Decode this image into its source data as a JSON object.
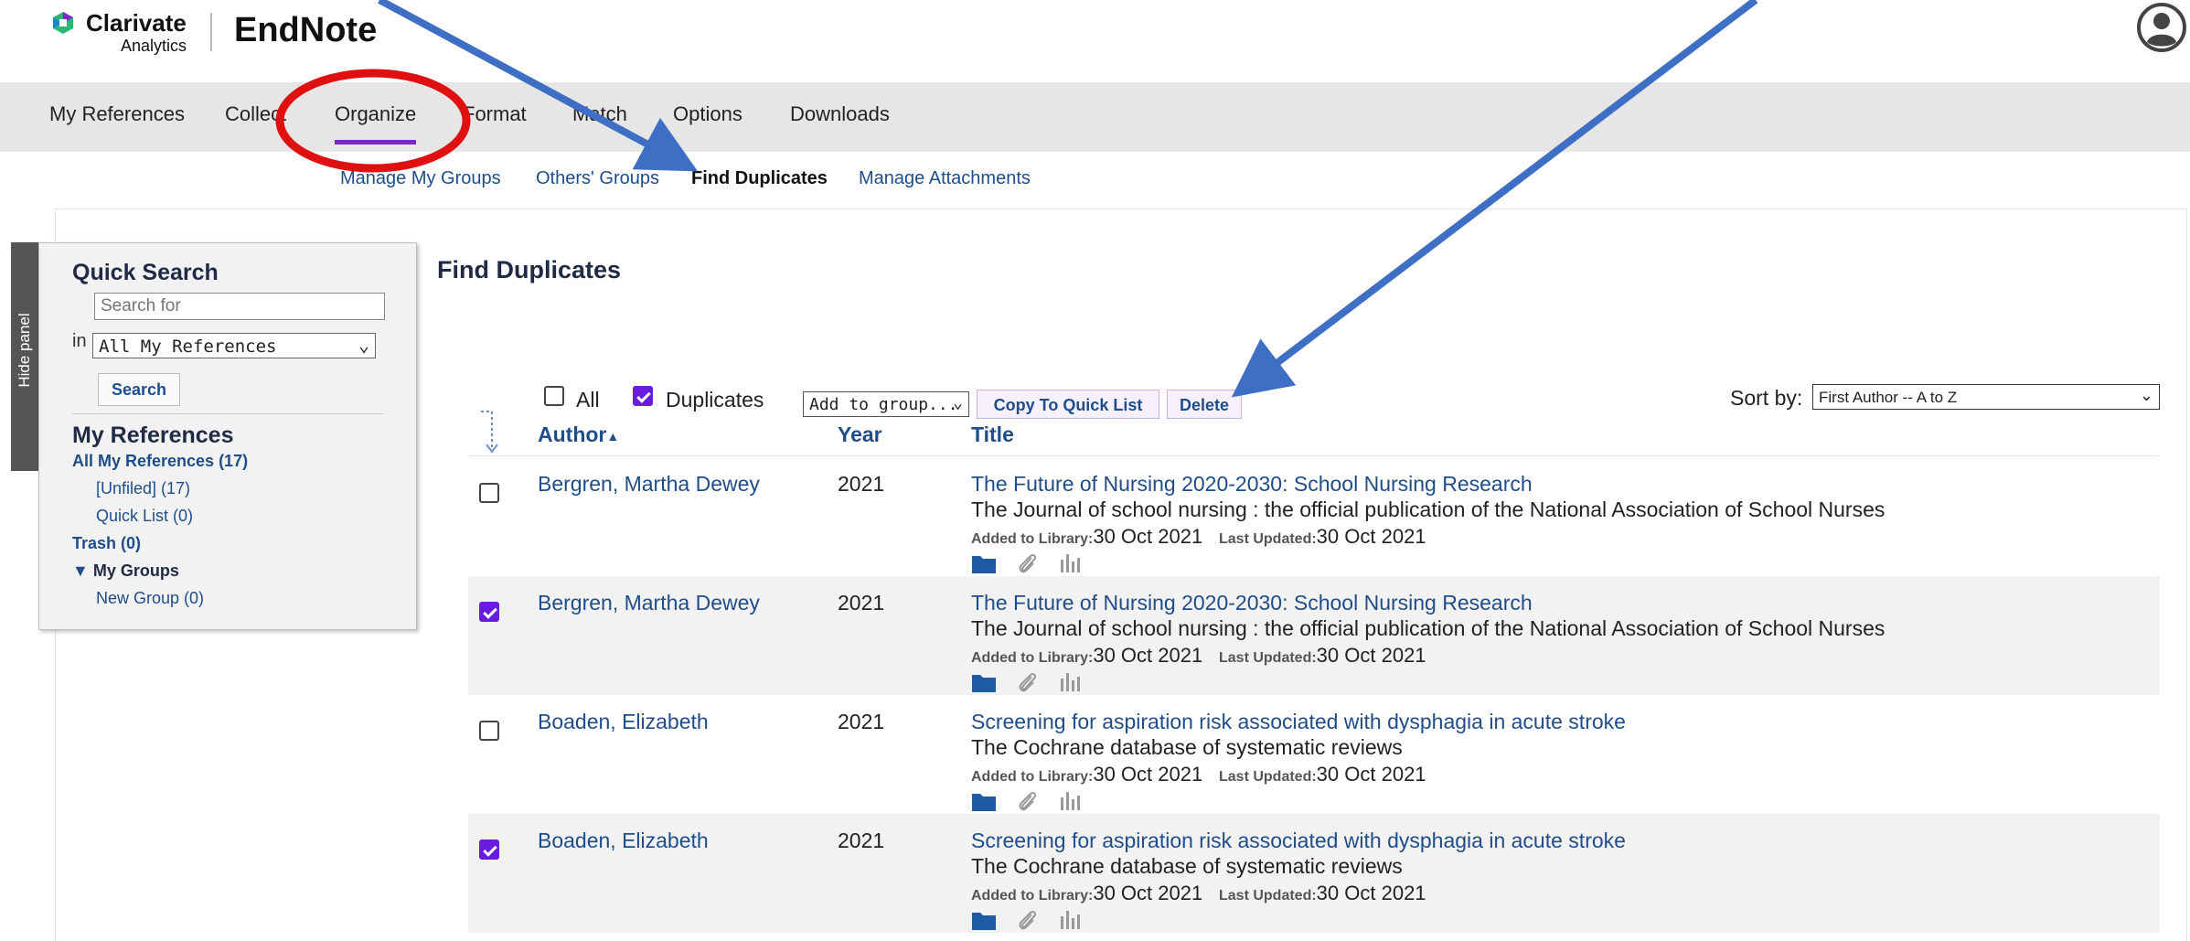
{
  "brand": {
    "company_line1": "Clarivate",
    "company_line2": "Analytics",
    "product": "EndNote"
  },
  "main_nav": {
    "items": [
      "My References",
      "Collect",
      "Organize",
      "Format",
      "Match",
      "Options",
      "Downloads"
    ],
    "active": "Organize"
  },
  "sub_nav": {
    "items": [
      "Manage My Groups",
      "Others' Groups",
      "Find Duplicates",
      "Manage Attachments"
    ],
    "active": "Find Duplicates"
  },
  "hide_panel": "Hide panel",
  "quick_search": {
    "heading": "Quick Search",
    "placeholder": "Search for",
    "in_label": "in",
    "scope_value": "All My References",
    "button": "Search"
  },
  "my_references": {
    "heading": "My References",
    "all": "All My References (17)",
    "unfiled": "[Unfiled] (17)",
    "quick_list": "Quick List (0)",
    "trash": "Trash (0)",
    "my_groups": "My Groups",
    "new_group": "New Group (0)"
  },
  "page_title": "Find Duplicates",
  "toolbar": {
    "all_label": "All",
    "all_checked": false,
    "duplicates_label": "Duplicates",
    "duplicates_checked": true,
    "add_to_group": "Add to group...",
    "copy_quick_list": "Copy To Quick List",
    "delete": "Delete",
    "sort_label": "Sort by:",
    "sort_value": "First Author -- A to Z"
  },
  "columns": {
    "author": "Author",
    "year": "Year",
    "title": "Title"
  },
  "meta_labels": {
    "added": "Added to Library:",
    "updated": "Last Updated:"
  },
  "rows": [
    {
      "checked": false,
      "shaded": false,
      "author": "Bergren, Martha Dewey",
      "year": "2021",
      "title": "The Future of Nursing 2020-2030: School Nursing Research",
      "journal": "The Journal of school nursing : the official publication of the National Association of School Nurses",
      "added": "30 Oct 2021",
      "updated": "30 Oct 2021"
    },
    {
      "checked": true,
      "shaded": true,
      "author": "Bergren, Martha Dewey",
      "year": "2021",
      "title": "The Future of Nursing 2020-2030: School Nursing Research",
      "journal": "The Journal of school nursing : the official publication of the National Association of School Nurses",
      "added": "30 Oct 2021",
      "updated": "30 Oct 2021"
    },
    {
      "checked": false,
      "shaded": false,
      "author": "Boaden, Elizabeth",
      "year": "2021",
      "title": "Screening for aspiration risk associated with dysphagia in acute stroke",
      "journal": "The Cochrane database of systematic reviews",
      "added": "30 Oct 2021",
      "updated": "30 Oct 2021"
    },
    {
      "checked": true,
      "shaded": true,
      "author": "Boaden, Elizabeth",
      "year": "2021",
      "title": "Screening for aspiration risk associated with dysphagia in acute stroke",
      "journal": "The Cochrane database of systematic reviews",
      "added": "30 Oct 2021",
      "updated": "30 Oct 2021"
    }
  ],
  "icons": {
    "logo": "clarivate-logo-icon",
    "user": "user-account-icon",
    "row_icons": [
      "folder-icon",
      "paperclip-icon",
      "bar-chart-icon"
    ]
  },
  "colors": {
    "accent": "#7a28c9",
    "checkbox": "#6a1be0",
    "link": "#1f4d8a",
    "annotation_arrow": "#3e6fc4",
    "annotation_circle": "#e01010"
  }
}
